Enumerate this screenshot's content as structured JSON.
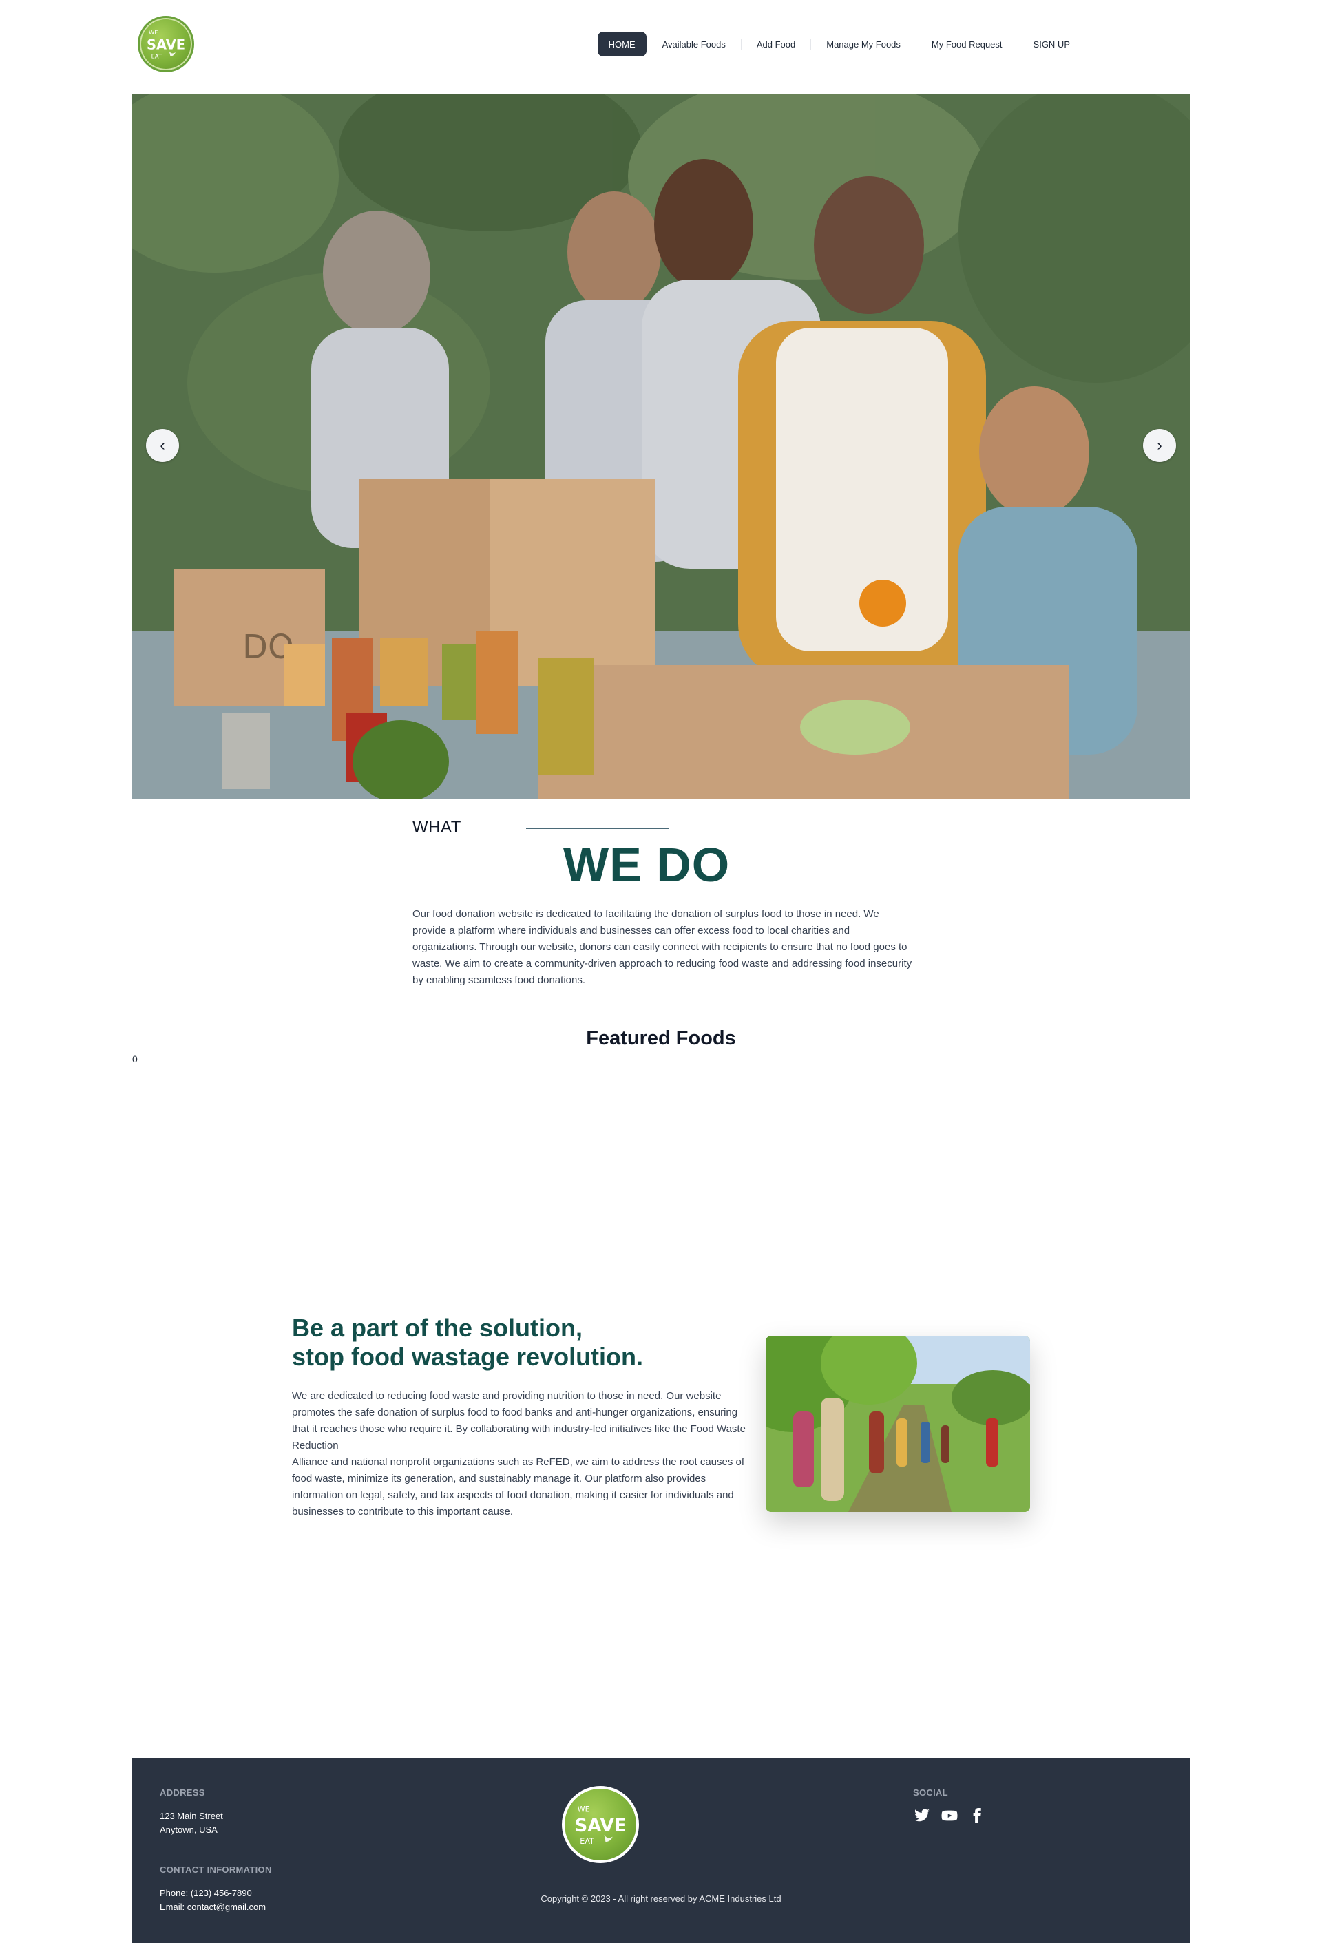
{
  "brand": {
    "logo_top": "WE",
    "logo_main": "SAVE",
    "logo_bottom": "EAT"
  },
  "nav": {
    "items": [
      {
        "label": "HOME",
        "active": true
      },
      {
        "label": "Available Foods",
        "active": false
      },
      {
        "label": "Add Food",
        "active": false
      },
      {
        "label": "Manage My Foods",
        "active": false
      },
      {
        "label": "My Food Request",
        "active": false
      },
      {
        "label": "SIGN UP",
        "active": false
      }
    ]
  },
  "hero": {
    "prev_label": "‹",
    "next_label": "›",
    "box_text": "DO"
  },
  "what_we_do": {
    "label": "WHAT",
    "heading": "WE DO",
    "paragraph": "Our food donation website is dedicated to facilitating the donation of surplus food to those in need. We provide a platform where individuals and businesses can offer excess food to local charities and organizations. Through our website, donors can easily connect with recipients to ensure that no food goes to waste. We aim to create a community-driven approach to reducing food waste and addressing food insecurity by enabling seamless food donations."
  },
  "featured": {
    "title": "Featured Foods",
    "count": "0"
  },
  "solution": {
    "heading_line1": "Be a part of the solution,",
    "heading_line2": "stop food wastage revolution.",
    "paragraph_1": "We are dedicated to reducing food waste and providing nutrition to those in need. Our website promotes the safe donation of surplus food to food banks and anti-hunger organizations, ensuring that it reaches those who require it. By collaborating with industry-led initiatives like the Food Waste Reduction",
    "paragraph_2": "Alliance and national nonprofit organizations such as ReFED, we aim to address the root causes of food waste, minimize its generation, and sustainably manage it. Our platform also provides information on legal, safety, and tax aspects of food donation, making it easier for individuals and businesses to contribute to this important cause."
  },
  "footer": {
    "address_label": "ADDRESS",
    "address_line1": "123 Main Street",
    "address_line2": "Anytown, USA",
    "contact_label": "CONTACT INFORMATION",
    "phone": "Phone: (123) 456-7890",
    "email": "Email: contact@gmail.com",
    "social_label": "SOCIAL",
    "copyright": "Copyright © 2023 - All right reserved by ACME Industries Ltd",
    "social_icons": [
      "twitter-icon",
      "youtube-icon",
      "facebook-icon"
    ]
  },
  "colors": {
    "nav_active_bg": "#2a3342",
    "accent_teal": "#134e4a",
    "footer_bg": "#2a3341",
    "logo_green": "#7fb23a"
  }
}
